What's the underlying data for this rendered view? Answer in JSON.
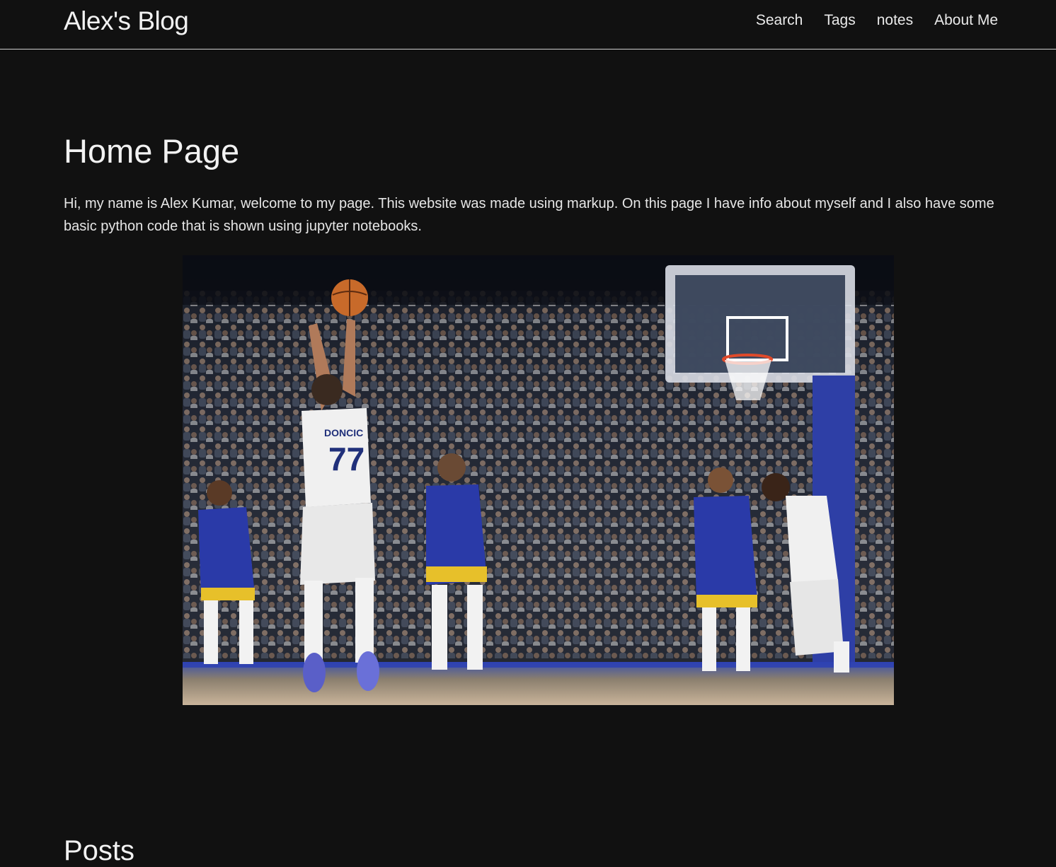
{
  "header": {
    "site_title": "Alex's Blog",
    "nav": [
      {
        "label": "Search"
      },
      {
        "label": "Tags"
      },
      {
        "label": "notes"
      },
      {
        "label": "About Me"
      }
    ]
  },
  "main": {
    "page_title": "Home Page",
    "intro": "Hi, my name is Alex Kumar, welcome to my page. This website was made using markup. On this page I have info about myself and I also have some basic python code that is shown using jupyter notebooks.",
    "hero_image": {
      "jersey_number": "77",
      "jersey_name": "DONCIC"
    },
    "posts_heading": "Posts"
  },
  "colors": {
    "background": "#111111",
    "text": "#e8e8e8",
    "header_border": "#cfcfcf"
  }
}
